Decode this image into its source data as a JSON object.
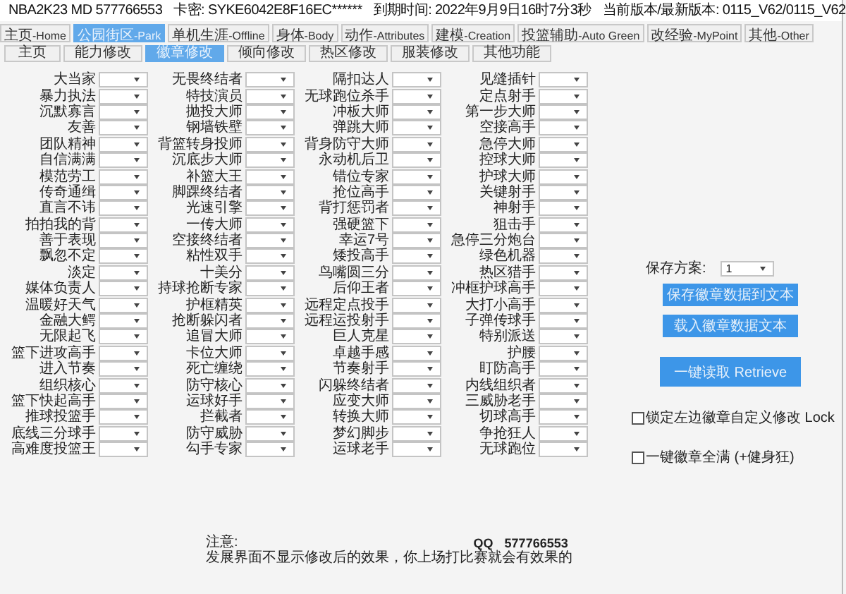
{
  "title_bar": {
    "segments": [
      "NBA2K23  MD  577766553",
      "卡密: SYKE6042E8F16EC******",
      "到期时间: 2022年9月9日16时7分3秒",
      "当前版本/最新版本: 0115_V62/0115_V62"
    ]
  },
  "main_tabs": [
    {
      "label": "主页",
      "sub": "-Home",
      "selected": false
    },
    {
      "label": "公园街区",
      "sub": "-Park",
      "selected": true
    },
    {
      "label": "单机生涯",
      "sub": "-Offline",
      "selected": false
    },
    {
      "label": "身体",
      "sub": "-Body",
      "selected": false
    },
    {
      "label": "动作",
      "sub": "-Attributes",
      "selected": false
    },
    {
      "label": "建模",
      "sub": "-Creation",
      "selected": false
    },
    {
      "label": "投篮辅助",
      "sub": "-Auto Green",
      "selected": false
    },
    {
      "label": "改经验",
      "sub": "-MyPoint",
      "selected": false
    },
    {
      "label": "其他",
      "sub": "-Other",
      "selected": false
    }
  ],
  "sub_tabs": [
    {
      "label": "主页",
      "selected": false
    },
    {
      "label": "能力修改",
      "selected": false
    },
    {
      "label": "徽章修改",
      "selected": true
    },
    {
      "label": "倾向修改",
      "selected": false
    },
    {
      "label": "热区修改",
      "selected": false
    },
    {
      "label": "服装修改",
      "selected": false
    },
    {
      "label": "其他功能",
      "selected": false
    }
  ],
  "badge_columns": [
    [
      "大当家",
      "暴力执法",
      "沉默寡言",
      "友善",
      "团队精神",
      "自信满满",
      "模范劳工",
      "传奇通缉",
      "直言不讳",
      "拍拍我的背",
      "善于表现",
      "飘忽不定",
      "淡定",
      "媒体负责人",
      "温暖好天气",
      "金融大鳄",
      "无限起飞",
      "篮下进攻高手",
      "进入节奏",
      "组织核心",
      "篮下快起高手",
      "推球投篮手",
      "底线三分球手",
      "高难度投篮王"
    ],
    [
      "无畏终结者",
      "特技演员",
      "抛投大师",
      "钢墙铁壁",
      "背篮转身投师",
      "沉底步大师",
      "补篮大王",
      "脚踝终结者",
      "光速引擎",
      "一传大师",
      "空接终结者",
      "粘性双手",
      "十美分",
      "持球抢断专家",
      "护框精英",
      "抢断躲闪者",
      "追冒大师",
      "卡位大师",
      "死亡缠绕",
      "防守核心",
      "运球好手",
      "拦截者",
      "防守威胁",
      "勾手专家"
    ],
    [
      "隔扣达人",
      "无球跑位杀手",
      "冲板大师",
      "弹跳大师",
      "背身防守大师",
      "永动机后卫",
      "错位专家",
      "抢位高手",
      "背打惩罚者",
      "强硬篮下",
      "幸运7号",
      "矮投高手",
      "鸟嘴圆三分",
      "后仰王者",
      "远程定点投手",
      "远程运投射手",
      "巨人克星",
      "卓越手感",
      "节奏射手",
      "闪躲终结者",
      "应变大师",
      "转换大师",
      "梦幻脚步",
      "运球老手"
    ],
    [
      "见缝插针",
      "定点射手",
      "第一步大师",
      "空接高手",
      "急停大师",
      "控球大师",
      "护球大师",
      "关键射手",
      "神射手",
      "狙击手",
      "急停三分炮台",
      "绿色机器",
      "热区猎手",
      "冲框护球高手",
      "大打小高手",
      "子弹传球手",
      "特别派送",
      "护腰",
      "盯防高手",
      "内线组织者",
      "三威胁老手",
      "切球高手",
      "争抢狂人",
      "无球跑位"
    ]
  ],
  "side_panel": {
    "scheme_label": "保存方案:",
    "scheme_value": "1",
    "buttons": [
      {
        "label": "保存徽章数据到文本",
        "kind": "small"
      },
      {
        "label": "载入徽章数据文本",
        "kind": "small"
      },
      {
        "label": "一键读取 Retrieve",
        "kind": "large"
      }
    ],
    "checkboxes": [
      {
        "label": "锁定左边徽章自定义修改 Lock",
        "checked": false
      },
      {
        "label": "一键徽章全满 (+健身狂)",
        "checked": false
      }
    ]
  },
  "footer": {
    "note_title": "注意:",
    "note_text": "发展界面不显示修改后的效果，你上场打比赛就会有效果的",
    "qq_label": "QQ",
    "qq_number": "577766553"
  }
}
